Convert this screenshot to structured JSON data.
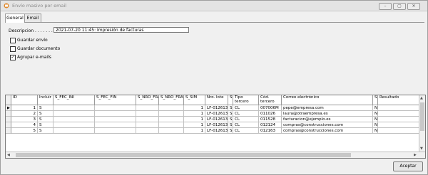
{
  "window": {
    "title": "Envío masivo por email"
  },
  "tabs": [
    {
      "label": "General"
    },
    {
      "label": "Email"
    }
  ],
  "form": {
    "descripcion_label": "Descripcion . . . . . . .",
    "descripcion_value": "2021-07-20 11:45: Impresión de facturas",
    "checkboxes": [
      {
        "label": "Guardar envío",
        "checked": false
      },
      {
        "label": "Guardar documento",
        "checked": false
      },
      {
        "label": "Agrupar e-mails",
        "checked": true
      }
    ]
  },
  "table": {
    "columns": [
      "ID",
      "Incluir",
      "S_FEC_INI",
      "S_FEC_FIN",
      "S_NRO_FRA",
      "S_NRO_FRA",
      "S_SIM",
      "Nro. lote",
      "S",
      "Tipo tercero",
      "Cód. tercero",
      "Correo electrónico",
      "S",
      "Resultado"
    ],
    "rows": [
      [
        "1",
        "S",
        "",
        "",
        "",
        "",
        "1",
        "LF-012613",
        "S",
        "CL",
        "007006M",
        "pepe@empresa.com",
        "N",
        ""
      ],
      [
        "2",
        "S",
        "",
        "",
        "",
        "",
        "1",
        "LF-012613",
        "S",
        "CL",
        "011026",
        "laura@otraempresa.es",
        "N",
        ""
      ],
      [
        "3",
        "S",
        "",
        "",
        "",
        "",
        "1",
        "LF-012613",
        "S",
        "CL",
        "011528",
        "facturacion@ejemplo.es",
        "N",
        ""
      ],
      [
        "4",
        "S",
        "",
        "",
        "",
        "",
        "1",
        "LF-012613",
        "S",
        "CL",
        "012124",
        "compras@construcciones.com",
        "N",
        ""
      ],
      [
        "5",
        "S",
        "",
        "",
        "",
        "",
        "1",
        "LF-012613",
        "S",
        "CL",
        "012163",
        "compras@construcciones.com",
        "N",
        ""
      ]
    ]
  },
  "buttons": {
    "accept": "Aceptar"
  },
  "icons": {
    "app": "envelope-icon",
    "minimize": "minimize-icon",
    "restore": "restore-icon",
    "close": "close-icon",
    "row_pointer": "row-pointer-icon"
  }
}
